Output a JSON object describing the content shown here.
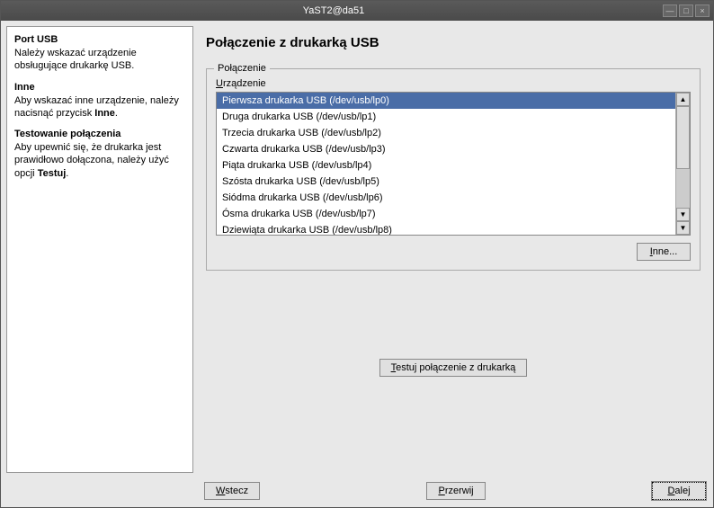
{
  "window": {
    "title": "YaST2@da51"
  },
  "sidebar": {
    "sections": [
      {
        "heading": "Port USB",
        "body": "Należy wskazać urządzenie obsługujące drukarkę USB."
      },
      {
        "heading": "Inne",
        "body_pre": "Aby wskazać inne urządzenie, należy nacisnąć przycisk ",
        "body_bold": "Inne",
        "body_post": "."
      },
      {
        "heading": "Testowanie połączenia",
        "body_pre": "Aby upewnić się, że drukarka jest prawidłowo dołączona, należy użyć opcji ",
        "body_bold": "Testuj",
        "body_post": "."
      }
    ]
  },
  "main": {
    "title": "Połączenie z drukarką USB",
    "fieldset_legend": "Połączenie",
    "list_label_ul": "U",
    "list_label_rest": "rządzenie",
    "items": [
      "Pierwsza drukarka USB (/dev/usb/lp0)",
      "Druga drukarka USB (/dev/usb/lp1)",
      "Trzecia drukarka USB (/dev/usb/lp2)",
      "Czwarta drukarka USB (/dev/usb/lp3)",
      "Piąta drukarka USB (/dev/usb/lp4)",
      "Szósta drukarka USB (/dev/usb/lp5)",
      "Siódma drukarka USB (/dev/usb/lp6)",
      "Ósma drukarka USB (/dev/usb/lp7)",
      "Dziewiąta drukarka USB (/dev/usb/lp8)"
    ],
    "selected_index": 0,
    "other_button_ul": "I",
    "other_button_rest": "nne...",
    "test_button_ul": "T",
    "test_button_rest": "estuj połączenie z drukarką"
  },
  "footer": {
    "back_ul": "W",
    "back_rest": "stecz",
    "abort_ul": "P",
    "abort_rest": "rzerwij",
    "next_ul": "D",
    "next_rest": "alej"
  }
}
